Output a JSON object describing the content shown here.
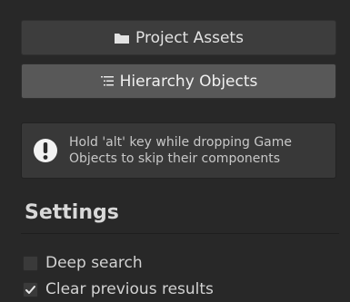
{
  "buttons": {
    "project_assets": {
      "label": "Project Assets",
      "icon": "folder-icon"
    },
    "hierarchy_objects": {
      "label": "Hierarchy Objects",
      "icon": "hierarchy-icon"
    }
  },
  "helpbox": {
    "icon": "warning-icon",
    "message": "Hold 'alt' key while dropping Game Objects to skip their components"
  },
  "settings": {
    "title": "Settings",
    "options": [
      {
        "label": "Deep search",
        "checked": false
      },
      {
        "label": "Clear previous results",
        "checked": true
      }
    ]
  }
}
